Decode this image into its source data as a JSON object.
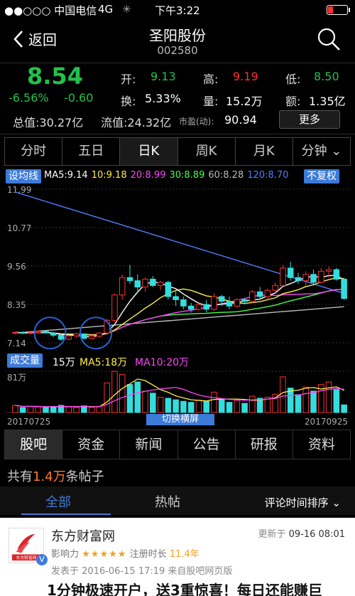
{
  "status": {
    "carrier": "●●○○○ 中国电信",
    "network": "4G",
    "time": "下午3:22",
    "battery_level": 0.25
  },
  "nav": {
    "back_label": "返回",
    "title": "圣阳股份",
    "code": "002580"
  },
  "quote": {
    "price": "8.54",
    "change_pct": "-6.56%",
    "change": "-0.60",
    "open_label": "开:",
    "open": "9.13",
    "high_label": "高:",
    "high": "9.19",
    "low_label": "低:",
    "low": "8.50",
    "turnover_label": "换:",
    "turnover": "5.33%",
    "volume_label": "量:",
    "volume": "15.2万",
    "amount_label": "额:",
    "amount": "1.35亿",
    "total_cap": "总值:30.27亿",
    "float_cap": "流值:24.32亿",
    "pe_label": "市盈(动):",
    "pe": "90.94",
    "more_label": "更多"
  },
  "period_tabs": [
    "分时",
    "五日",
    "日K",
    "周K",
    "月K",
    "分钟"
  ],
  "active_period": 2,
  "ma": {
    "setting_label": "设均线",
    "values": [
      "MA5:9.14",
      "10:9.18",
      "20:8.99",
      "30:8.89",
      "60:8.28",
      "120:8.70"
    ],
    "colors": [
      "#ffffff",
      "#ffee44",
      "#ff44ff",
      "#44ff44",
      "#bbbbbb",
      "#4f7fff"
    ],
    "adjust_label": "不复权"
  },
  "chart_data": {
    "type": "candlestick",
    "price_axis": [
      "11.99",
      "10.77",
      "9.56",
      "8.35",
      "7.14"
    ],
    "ylim": [
      7.14,
      11.99
    ],
    "date_start": "20170725",
    "date_end": "20170925",
    "candles": [
      [
        7.45,
        7.48,
        7.4,
        7.47
      ],
      [
        7.47,
        7.5,
        7.42,
        7.44
      ],
      [
        7.44,
        7.49,
        7.4,
        7.46
      ],
      [
        7.46,
        7.52,
        7.43,
        7.5
      ],
      [
        7.5,
        7.52,
        7.43,
        7.45
      ],
      [
        7.45,
        7.49,
        7.32,
        7.38
      ],
      [
        7.38,
        7.42,
        7.2,
        7.25
      ],
      [
        7.25,
        7.4,
        7.22,
        7.36
      ],
      [
        7.36,
        7.45,
        7.3,
        7.42
      ],
      [
        7.42,
        7.44,
        7.24,
        7.28
      ],
      [
        7.28,
        7.4,
        7.25,
        7.35
      ],
      [
        7.35,
        7.48,
        7.3,
        7.45
      ],
      [
        7.45,
        7.9,
        7.4,
        7.85
      ],
      [
        7.85,
        8.7,
        7.8,
        8.65
      ],
      [
        8.65,
        9.3,
        8.5,
        9.2
      ],
      [
        9.2,
        9.6,
        9.0,
        9.1
      ],
      [
        9.1,
        9.3,
        8.7,
        8.9
      ],
      [
        8.9,
        9.2,
        8.75,
        9.15
      ],
      [
        9.15,
        9.25,
        8.9,
        8.95
      ],
      [
        8.95,
        9.1,
        8.8,
        9.05
      ],
      [
        9.05,
        9.1,
        8.5,
        8.6
      ],
      [
        8.6,
        8.8,
        8.3,
        8.5
      ],
      [
        8.5,
        8.6,
        8.2,
        8.3
      ],
      [
        8.3,
        8.4,
        8.1,
        8.2
      ],
      [
        8.2,
        8.4,
        8.15,
        8.35
      ],
      [
        8.35,
        8.5,
        8.1,
        8.2
      ],
      [
        8.2,
        8.7,
        8.15,
        8.6
      ],
      [
        8.6,
        8.65,
        8.3,
        8.45
      ],
      [
        8.45,
        8.6,
        8.2,
        8.3
      ],
      [
        8.3,
        8.55,
        8.25,
        8.5
      ],
      [
        8.5,
        8.55,
        8.35,
        8.45
      ],
      [
        8.45,
        8.8,
        8.4,
        8.75
      ],
      [
        8.75,
        8.9,
        8.55,
        8.6
      ],
      [
        8.6,
        8.85,
        8.5,
        8.8
      ],
      [
        8.8,
        9.05,
        8.7,
        8.95
      ],
      [
        8.95,
        9.6,
        8.9,
        9.5
      ],
      [
        9.5,
        9.7,
        9.1,
        9.2
      ],
      [
        9.2,
        9.35,
        9.0,
        9.1
      ],
      [
        9.1,
        9.4,
        8.95,
        9.3
      ],
      [
        9.3,
        9.45,
        9.0,
        9.05
      ],
      [
        9.05,
        9.5,
        9.0,
        9.4
      ],
      [
        9.4,
        9.55,
        9.2,
        9.45
      ],
      [
        9.45,
        9.5,
        9.1,
        9.15
      ],
      [
        9.15,
        9.19,
        8.5,
        8.54
      ]
    ],
    "volume_label": "成交量",
    "volume_value": "15万",
    "vol_ma5": "MA5:18万",
    "vol_ma10": "MA10:20万",
    "volume_axis_top": "81万",
    "volumes": [
      14,
      10,
      12,
      11,
      10,
      12,
      14,
      11,
      10,
      13,
      10,
      12,
      58,
      81,
      75,
      55,
      60,
      42,
      38,
      30,
      28,
      25,
      22,
      20,
      24,
      22,
      40,
      26,
      20,
      24,
      18,
      32,
      28,
      30,
      36,
      70,
      48,
      35,
      50,
      42,
      55,
      60,
      45,
      15
    ],
    "landscape_label": "切换横屏"
  },
  "bottom_tabs": [
    "股吧",
    "资金",
    "新闻",
    "公告",
    "研报",
    "资料"
  ],
  "active_bottom_tab": 0,
  "forum": {
    "count_prefix": "共有",
    "count": "1.4万",
    "count_suffix": "条帖子",
    "tab_all": "全部",
    "tab_hot": "热帖",
    "sort_label": "评论时间排序"
  },
  "post": {
    "author": "东方财富网",
    "logo_text": "东方财富网",
    "updated": "更新于",
    "updated_time": "09-16 08:01",
    "influence_label": "影响力",
    "stars": "★★★★★",
    "register_label": "注册时长",
    "register_value": "11.4年",
    "posted": "发表于 2016-06-15 17:19 来自股吧网页版",
    "headline": "1分钟极速开户，送3重惊喜！每日还能赚巨"
  }
}
